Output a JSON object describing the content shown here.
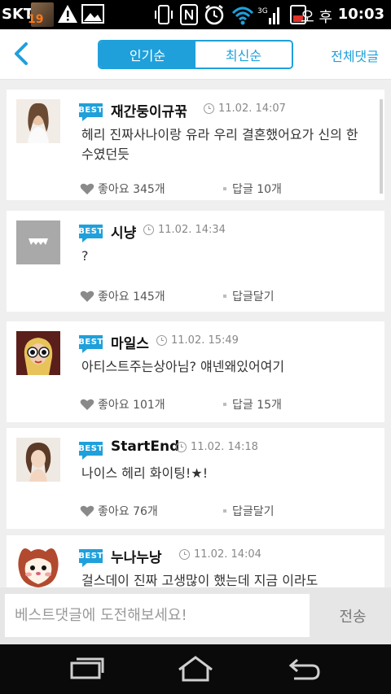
{
  "status_bar": {
    "carrier": "SKT",
    "notification_badge": "19",
    "ampm": "오 후",
    "time": "10:03"
  },
  "header": {
    "tabs": [
      {
        "label": "인기순",
        "active": true
      },
      {
        "label": "최신순",
        "active": false
      }
    ],
    "all_comments_label": "전체댓글",
    "accent_color": "#1fa0db"
  },
  "comments": [
    {
      "badge": "BEST",
      "nickname": "재간둥이규꾺",
      "time": "11.02. 14:07",
      "text": "헤리 진짜사나이랑 유라 우리 결혼했어요가 신의 한수였던듯",
      "likes": "좋아요 345개",
      "replies": "답글 10개",
      "avatar": "woman-portrait"
    },
    {
      "badge": "BEST",
      "nickname": "시냥",
      "time": "11.02. 14:34",
      "text": "?",
      "likes": "좋아요 145개",
      "replies": "답글달기",
      "avatar": "default-gray"
    },
    {
      "badge": "BEST",
      "nickname": "마일스",
      "time": "11.02. 15:49",
      "text": "아티스트주는상아님? 얘넨왜있어여기",
      "likes": "좋아요 101개",
      "replies": "답글 15개",
      "avatar": "sunglasses-portrait"
    },
    {
      "badge": "BEST",
      "nickname": "StartEnd",
      "time": "11.02. 14:18",
      "text": "나이스 헤리 화이팅!★!",
      "likes": "좋아요 76개",
      "replies": "답글달기",
      "avatar": "woman-portrait-2"
    },
    {
      "badge": "BEST",
      "nickname": "누나누낭",
      "time": "11.02. 14:04",
      "text": "걸스데이 진짜 고생많이 했는데 지금 이라도",
      "likes": "",
      "replies": "",
      "avatar": "hamster-cartoon"
    }
  ],
  "input_bar": {
    "placeholder": "베스트댓글에 도전해보세요!",
    "send_label": "전송"
  }
}
